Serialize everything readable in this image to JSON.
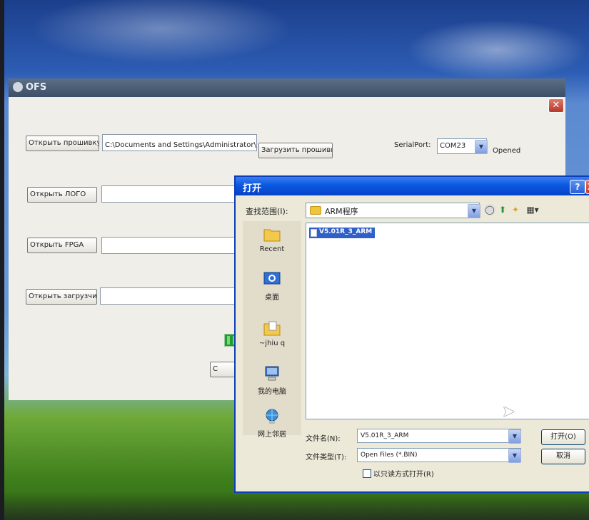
{
  "ofs": {
    "title": "OFS",
    "close_glyph": "✕",
    "open_firmware_label": "Открыть прошивку",
    "firmware_path": "C:\\Documents and Settings\\Administrator\\桌面",
    "load_firmware_label": "Загрузить прошивку",
    "serial_port_label": "SerialPort:",
    "serial_port_value": "COM23",
    "status": "Opened",
    "open_logo_label": "Открыть ЛОГО",
    "open_fpga_label": "Открыть FPGA",
    "open_bootloader_label": "Открыть загрузчик",
    "partial_button_label": "C"
  },
  "dialog": {
    "title": "打开",
    "help_glyph": "?",
    "close_glyph": "X",
    "look_in_label": "查找范围(I):",
    "look_in_value": "ARM程序",
    "places": [
      {
        "label": "Recent",
        "icon": "recent-folder-icon"
      },
      {
        "label": "桌面",
        "icon": "desktop-icon"
      },
      {
        "label": "~jhiu q",
        "icon": "my-documents-icon"
      },
      {
        "label": "我的电脑",
        "icon": "my-computer-icon"
      },
      {
        "label": "网上邻居",
        "icon": "network-places-icon"
      }
    ],
    "files": [
      "V5.01R_3_ARM"
    ],
    "filename_label": "文件名(N):",
    "filename_value": "V5.01R_3_ARM",
    "filetype_label": "文件类型(T):",
    "filetype_value": "Open Files (*.BIN)",
    "open_button": "打开(O)",
    "cancel_button": "取消",
    "readonly_label": "以只读方式打开(R)"
  },
  "colors": {
    "xp_titlebar_blue": "#0a58e0",
    "ofs_titlebar": "#3d4f66",
    "close_red": "#c23a28",
    "selection_blue": "#2f5fc8",
    "progress_green": "#1f9e2b"
  }
}
